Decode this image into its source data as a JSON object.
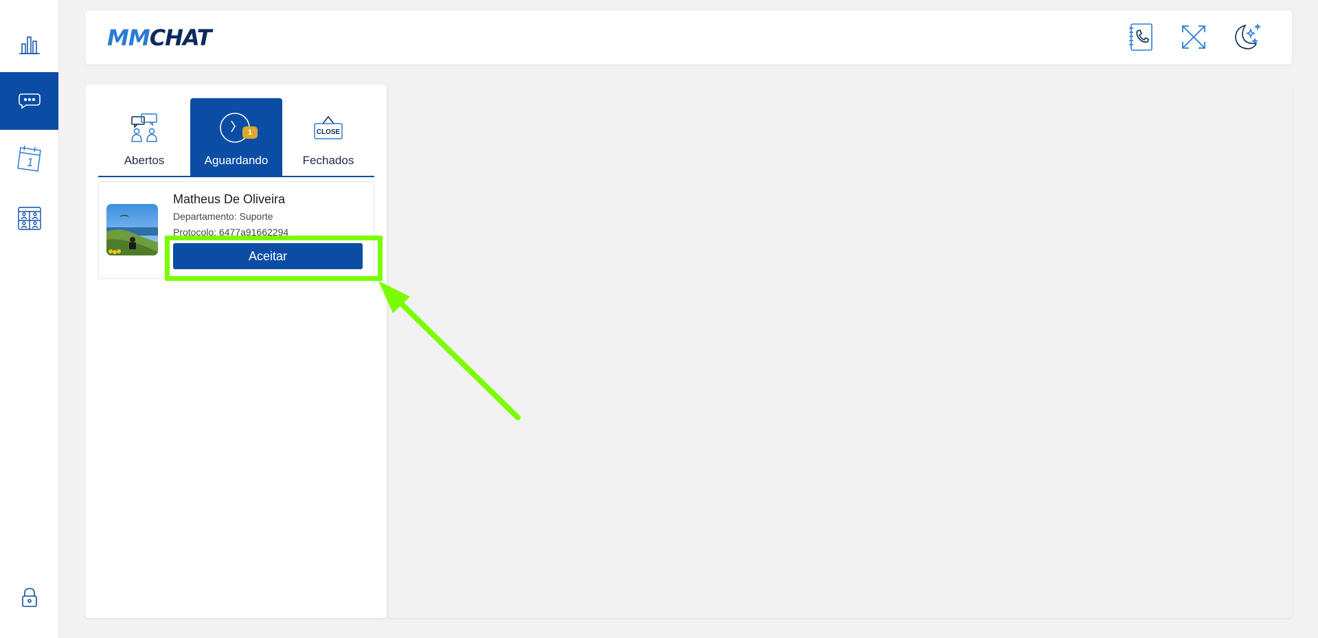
{
  "app": {
    "logo_mm": "MM",
    "logo_chat": "CHAT"
  },
  "sidebar": {
    "items": [
      {
        "name": "dashboard",
        "icon": "bar-chart-icon",
        "active": false
      },
      {
        "name": "chat",
        "icon": "chat-bubble-icon",
        "active": true
      },
      {
        "name": "calendar",
        "icon": "calendar-icon",
        "active": false,
        "day": "1"
      },
      {
        "name": "contacts",
        "icon": "contacts-grid-icon",
        "active": false
      },
      {
        "name": "lock",
        "icon": "lock-icon",
        "active": false
      }
    ]
  },
  "header": {
    "icons": [
      "phonebook-icon",
      "fullscreen-icon",
      "dark-mode-icon"
    ]
  },
  "tabs": [
    {
      "label": "Abertos",
      "icon": "group-chat-icon",
      "active": false
    },
    {
      "label": "Aguardando",
      "icon": "clock-icon",
      "active": true,
      "badge": "1"
    },
    {
      "label": "Fechados",
      "icon": "close-sign-icon",
      "active": false,
      "icon_text": "CLOSE"
    }
  ],
  "waiting_list": [
    {
      "name": "Matheus De Oliveira",
      "department": "Departamento: Suporte",
      "protocol": "Protocolo: 6477a91662294",
      "button": "Aceitar"
    }
  ],
  "colors": {
    "primary": "#0b4da5",
    "badge": "#d9a82c",
    "highlight": "#7cfc00",
    "logo_light": "#2b7bd3",
    "logo_dark": "#0c2a5c"
  }
}
